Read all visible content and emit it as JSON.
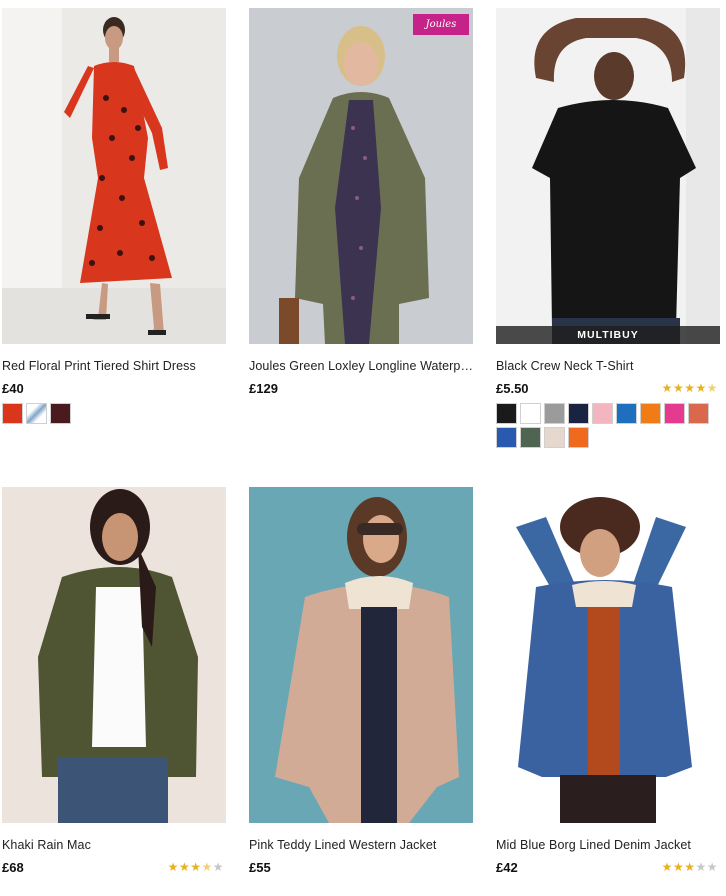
{
  "products": [
    {
      "name": "Red Floral Print Tiered Shirt Dress",
      "price": "£40",
      "swatches": [
        "#d9361c",
        "#7fa6c8",
        "#4a1b1e"
      ]
    },
    {
      "name": "Joules Green Loxley Longline Waterpr...",
      "price": "£129",
      "brand_badge": "Joules"
    },
    {
      "name": "Black Crew Neck T-Shirt",
      "price": "£5.50",
      "rating": 4.5,
      "badge": "MULTIBUY",
      "swatches": [
        "#1a1a1a",
        "#ffffff",
        "#9b9b9b",
        "#1b2342",
        "#f3b6c0",
        "#1f6fbf",
        "#ef7c16",
        "#e43a8f",
        "#d9684c",
        "#2a5ab0",
        "#4f6552",
        "#e6d8cc",
        "#ef6a1c"
      ]
    },
    {
      "name": "Khaki Rain Mac",
      "price": "£68",
      "rating": 3.5
    },
    {
      "name": "Pink Teddy Lined Western Jacket",
      "price": "£55"
    },
    {
      "name": "Mid Blue Borg Lined Denim Jacket",
      "price": "£42",
      "rating": 3
    }
  ],
  "colors": {
    "star_on": "#e7b11f",
    "star_off": "#c7c7c7",
    "joules_pink": "#c6238a"
  }
}
